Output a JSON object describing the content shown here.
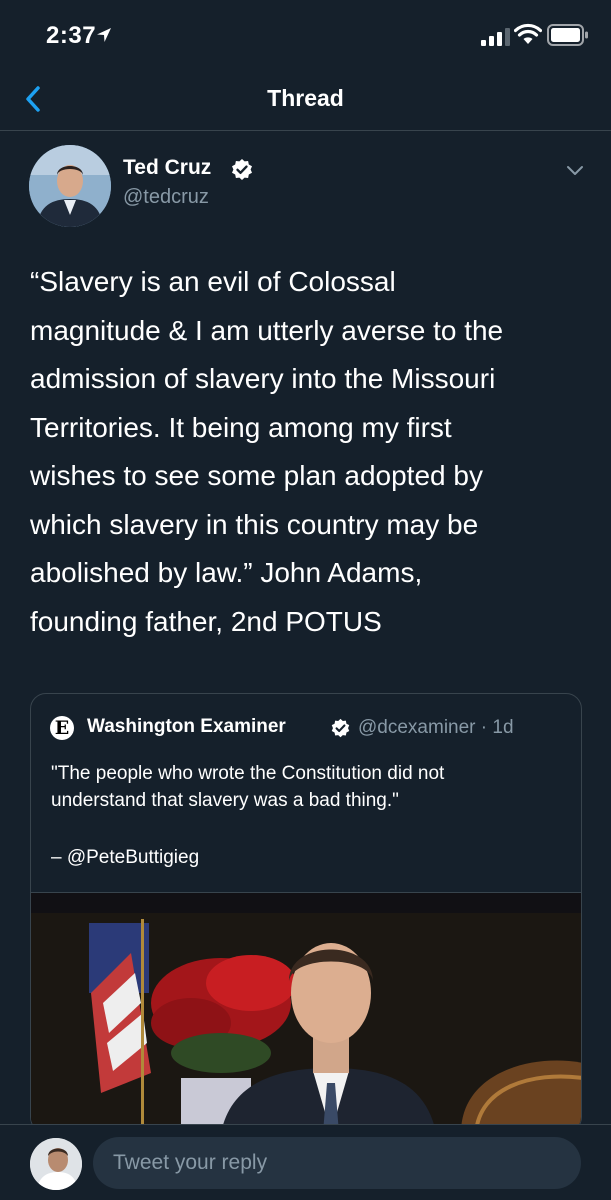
{
  "status_bar": {
    "time": "2:37"
  },
  "nav": {
    "title": "Thread"
  },
  "tweet": {
    "author_name": "Ted Cruz",
    "author_handle": "@tedcruz",
    "text_lines": [
      "“Slavery is an evil of Colossal",
      "magnitude & I am utterly averse to the",
      "admission of slavery into the Missouri",
      "Territories. It being among my first",
      "wishes to see some plan adopted by",
      "which slavery in this country may be",
      "abolished by law.” John Adams,",
      "founding father, 2nd POTUS"
    ]
  },
  "quote": {
    "logo_letter": "E",
    "name": "Washington Examiner",
    "handle_time": "@dcexaminer · 1d",
    "text_lines": [
      "\"The people who wrote the Constitution did not",
      "understand that slavery was a bad thing.\""
    ],
    "attribution": "– @PeteButtigieg"
  },
  "reply": {
    "placeholder": "Tweet your reply"
  },
  "colors": {
    "background": "#15202b",
    "secondary_text": "#8899a6",
    "accent": "#1da1f2",
    "border": "#38444d"
  },
  "icons": [
    "location-arrow-icon",
    "signal-icon",
    "wifi-icon",
    "battery-icon",
    "back-chevron-icon",
    "verified-badge-icon",
    "chevron-down-icon"
  ]
}
